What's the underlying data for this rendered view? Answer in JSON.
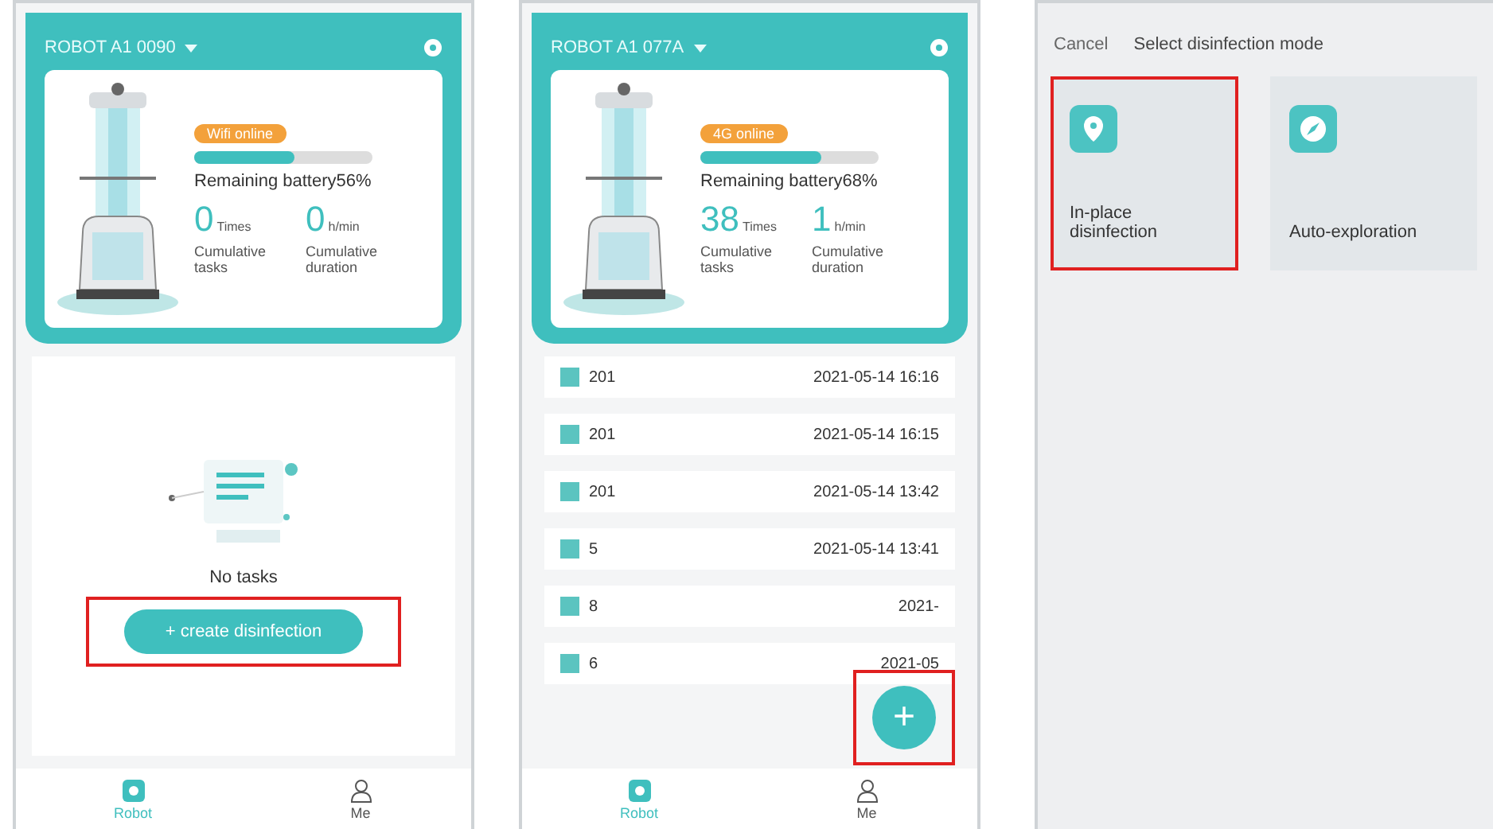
{
  "screens": [
    {
      "kind": "empty",
      "robot": {
        "name": "ROBOT A1 0090",
        "badge": "Wifi online",
        "level": 0.56,
        "battery": "Remaining battery56%",
        "stats": [
          {
            "value": "0",
            "unit": "Times",
            "label": "Cumulative tasks"
          },
          {
            "value": "0",
            "unit": "h/min",
            "label": "Cumulative duration"
          }
        ]
      },
      "empty_text": "No tasks",
      "create_button": {
        "label": "+ create disinfection",
        "highlighted": true
      },
      "nav": [
        {
          "label": "Robot",
          "kind": "robot",
          "selected": true
        },
        {
          "label": "Me",
          "kind": "person",
          "selected": false
        }
      ]
    },
    {
      "kind": "list",
      "robot": {
        "name": "ROBOT A1 077A",
        "badge": "4G online",
        "level": 0.68,
        "battery": "Remaining battery68%",
        "stats": [
          {
            "value": "38",
            "unit": "Times",
            "label": "Cumulative tasks"
          },
          {
            "value": "1",
            "unit": "h/min",
            "label": "Cumulative duration"
          }
        ]
      },
      "tasks": [
        {
          "name": "201",
          "time": "2021-05-14 16:16"
        },
        {
          "name": "201",
          "time": "2021-05-14 16:15"
        },
        {
          "name": "201",
          "time": "2021-05-14 13:42"
        },
        {
          "name": "5",
          "time": "2021-05-14 13:41"
        },
        {
          "name": "8",
          "time": "2021-"
        },
        {
          "name": "6",
          "time": "2021-05"
        }
      ],
      "fab": {
        "label": "+",
        "highlighted": true
      },
      "nav": [
        {
          "label": "Robot",
          "kind": "robot",
          "selected": true
        },
        {
          "label": "Me",
          "kind": "person",
          "selected": false
        }
      ]
    },
    {
      "kind": "modes",
      "cancel": "Cancel",
      "title": "Select disinfection mode",
      "modes": [
        {
          "label": "In-place disinfection",
          "kind": "pin",
          "highlighted": true
        },
        {
          "label": "Auto-exploration",
          "kind": "compass",
          "highlighted": false
        }
      ]
    }
  ]
}
